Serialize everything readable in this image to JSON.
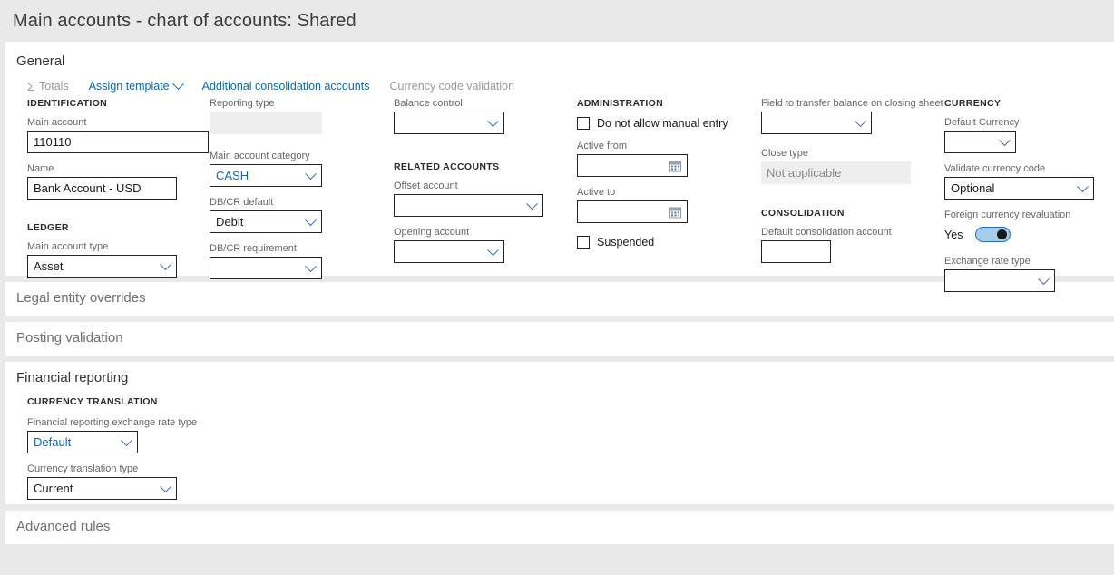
{
  "header": {
    "title": "Main accounts - chart of accounts: Shared"
  },
  "sections": {
    "general": {
      "title": "General"
    },
    "legal_entity_overrides": {
      "title": "Legal entity overrides"
    },
    "posting_validation": {
      "title": "Posting validation"
    },
    "financial_reporting": {
      "title": "Financial reporting"
    },
    "advanced_rules": {
      "title": "Advanced rules"
    }
  },
  "toolbar": {
    "items": [
      {
        "label": "Totals",
        "icon": "sigma-icon",
        "enabled": false
      },
      {
        "label": "Assign template",
        "icon": "chevron-down-icon",
        "enabled": true
      },
      {
        "label": "Additional consolidation accounts",
        "enabled": true
      },
      {
        "label": "Currency code validation",
        "enabled": false
      }
    ]
  },
  "groups": {
    "identification": "IDENTIFICATION",
    "ledger": "LEDGER",
    "related_accounts": "RELATED ACCOUNTS",
    "administration": "ADMINISTRATION",
    "consolidation": "CONSOLIDATION",
    "currency": "CURRENCY",
    "currency_translation": "CURRENCY TRANSLATION"
  },
  "fields": {
    "main_account": {
      "label": "Main account",
      "value": "110110"
    },
    "name": {
      "label": "Name",
      "value": "Bank Account - USD"
    },
    "main_account_type": {
      "label": "Main account type",
      "value": "Asset"
    },
    "reporting_type": {
      "label": "Reporting type",
      "value": ""
    },
    "main_account_category": {
      "label": "Main account category",
      "value": "CASH"
    },
    "dbcr_default": {
      "label": "DB/CR default",
      "value": "Debit"
    },
    "dbcr_requirement": {
      "label": "DB/CR requirement",
      "value": ""
    },
    "balance_control": {
      "label": "Balance control",
      "value": ""
    },
    "offset_account": {
      "label": "Offset account",
      "value": ""
    },
    "opening_account": {
      "label": "Opening account",
      "value": ""
    },
    "do_not_allow_manual_entry": {
      "label": "Do not allow manual entry",
      "checked": false
    },
    "active_from": {
      "label": "Active from",
      "value": ""
    },
    "active_to": {
      "label": "Active to",
      "value": ""
    },
    "suspended": {
      "label": "Suspended",
      "checked": false
    },
    "field_to_transfer": {
      "label": "Field to transfer balance on closing sheet",
      "value": ""
    },
    "close_type": {
      "label": "Close type",
      "value": "Not applicable"
    },
    "default_consolidation_account": {
      "label": "Default consolidation account",
      "value": ""
    },
    "default_currency": {
      "label": "Default Currency",
      "value": ""
    },
    "validate_currency_code": {
      "label": "Validate currency code",
      "value": "Optional"
    },
    "foreign_currency_revaluation": {
      "label": "Foreign currency revaluation",
      "value": "Yes",
      "on": true
    },
    "exchange_rate_type": {
      "label": "Exchange rate type",
      "value": ""
    },
    "fr_exchange_rate_type": {
      "label": "Financial reporting exchange rate type",
      "value": "Default"
    },
    "currency_translation_type": {
      "label": "Currency translation type",
      "value": "Current"
    }
  },
  "colors": {
    "link": "#0b6ab0",
    "page_bg": "#e9e9e9",
    "toggle_on": "#a6cdec",
    "disabled_text": "#8a8a8a"
  }
}
